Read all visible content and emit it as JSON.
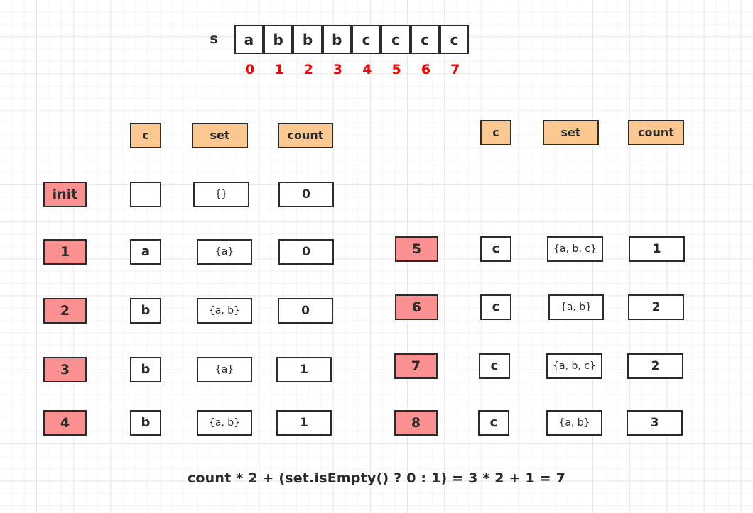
{
  "string_strip": {
    "label": "s",
    "chars": [
      "a",
      "b",
      "b",
      "b",
      "c",
      "c",
      "c",
      "c"
    ],
    "indices": [
      "0",
      "1",
      "2",
      "3",
      "4",
      "5",
      "6",
      "7"
    ],
    "index_color": "#ff0000"
  },
  "colors": {
    "header_fill": "#fbc892",
    "row_label_fill": "#fb9090",
    "border": "#2b2b2b",
    "grid_minor": "#f4f4f4",
    "grid_major": "#e8e8e8",
    "background": "#ffffff"
  },
  "left_table": {
    "headers": [
      "c",
      "set",
      "count"
    ],
    "rows": [
      {
        "label": "init",
        "c": "",
        "set": "{}",
        "count": "0"
      },
      {
        "label": "1",
        "c": "a",
        "set": "{a}",
        "count": "0"
      },
      {
        "label": "2",
        "c": "b",
        "set": "{a, b}",
        "count": "0"
      },
      {
        "label": "3",
        "c": "b",
        "set": "{a}",
        "count": "1"
      },
      {
        "label": "4",
        "c": "b",
        "set": "{a, b}",
        "count": "1"
      }
    ]
  },
  "right_table": {
    "headers": [
      "c",
      "set",
      "count"
    ],
    "rows": [
      {
        "label": "5",
        "c": "c",
        "set": "{a, b, c}",
        "count": "1"
      },
      {
        "label": "6",
        "c": "c",
        "set": "{a, b}",
        "count": "2"
      },
      {
        "label": "7",
        "c": "c",
        "set": "{a, b, c}",
        "count": "2"
      },
      {
        "label": "8",
        "c": "c",
        "set": "{a, b}",
        "count": "3"
      }
    ]
  },
  "formula": "count * 2 + (set.isEmpty() ? 0 : 1) = 3 * 2 + 1 = 7"
}
